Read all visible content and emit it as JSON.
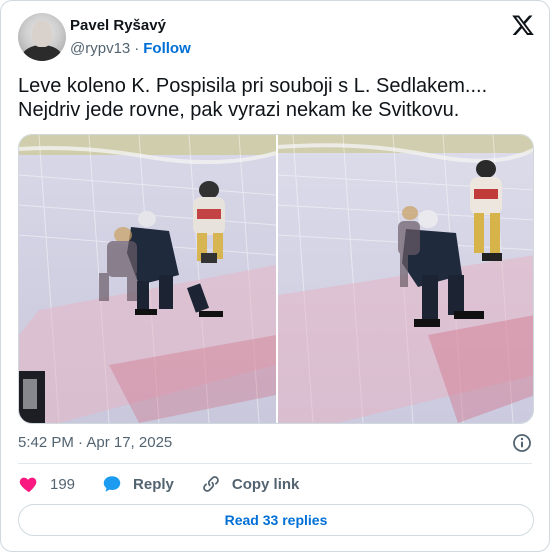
{
  "author": {
    "name": "Pavel Ryšavý",
    "handle": "@rypv13",
    "separator": "·",
    "follow_label": "Follow"
  },
  "tweet": {
    "text_line1": "Leve koleno K. Pospisila pri souboji s L. Sedlakem....",
    "text_line2": "Nejdriv jede rovne, pak vyrazi nekam ke Svitkovu.",
    "timestamp": "5:42 PM · Apr 17, 2025"
  },
  "actions": {
    "like_count": "199",
    "reply_label": "Reply",
    "copy_link_label": "Copy link"
  },
  "read_replies_label": "Read 33 replies",
  "colors": {
    "like_red": "#f91880",
    "link_blue": "#006fd6",
    "secondary_text": "#536471",
    "border": "#cfd9de"
  },
  "icons": [
    "x-logo-icon",
    "info-icon",
    "heart-icon",
    "reply-bubble-icon",
    "link-icon"
  ]
}
